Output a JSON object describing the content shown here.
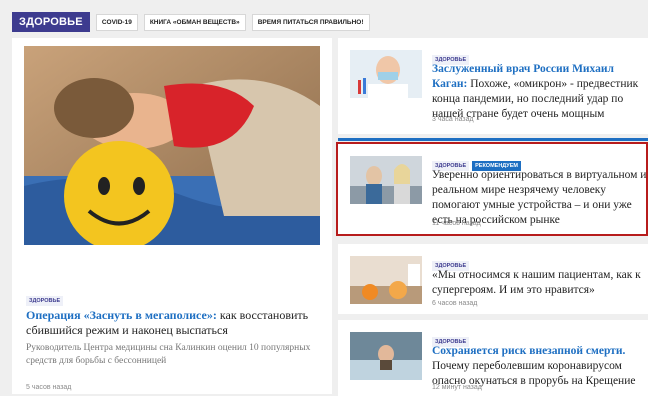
{
  "topbar": {
    "section": "ЗДОРОВЬЕ",
    "chips": [
      "COVID-19",
      "КНИГА «ОБМАН ВЕЩЕСТВ»",
      "ВРЕМЯ ПИТАТЬСЯ ПРАВИЛЬНО!"
    ]
  },
  "feature": {
    "badge": "ЗДОРОВЬЕ",
    "title_highlight": "Операция «Заснуть в мегаполисе»:",
    "title_rest": " как восстановить сбившийся режим и наконец выспаться",
    "lead": "Руководитель Центра медицины сна Калинкин оценил 10 популярных средств для борьбы с бессонницей",
    "time": "5 часов назад"
  },
  "news": [
    {
      "badge": "ЗДОРОВЬЕ",
      "highlight": "Заслуженный врач России Михаил Каган:",
      "rest": " Похоже, «омикрон» - предвестник конца пандемии, но последний удар по нашей стране будет очень мощным",
      "time": "3 часа назад"
    },
    {
      "badge": "ЗДОРОВЬЕ",
      "badge2": "РЕКОМЕНДУЕМ",
      "highlight": "",
      "rest": "Уверенно ориентироваться в виртуальном и реальном мире незрячему человеку помогают умные устройства – и они уже есть на российском рынке",
      "time": "11 часов назад"
    },
    {
      "badge": "ЗДОРОВЬЕ",
      "highlight": "",
      "rest": "«Мы относимся к нашим пациентам, как к супергероям. И им это нравится»",
      "time": "6 часов назад"
    },
    {
      "badge": "ЗДОРОВЬЕ",
      "highlight": "Сохраняется риск внезапной смерти.",
      "rest": " Почему переболевшим коронавирусом опасно окунаться в прорубь на Крещение",
      "time": "12 минут назад"
    }
  ],
  "colors": {
    "brand": "#3d3b8f",
    "link": "#1e6fc2",
    "highlight_border": "#b71c1c"
  }
}
